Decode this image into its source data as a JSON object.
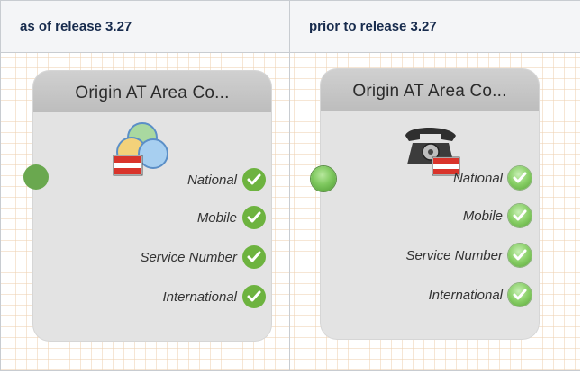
{
  "columns": [
    {
      "header": "as of release 3.27",
      "node": {
        "title": "Origin AT Area Co...",
        "icon": "area-code-flag-icon",
        "exits": [
          {
            "label": "National"
          },
          {
            "label": "Mobile"
          },
          {
            "label": "Service Number"
          },
          {
            "label": "International"
          }
        ]
      }
    },
    {
      "header": "prior to release 3.27",
      "node": {
        "title": "Origin AT Area Co...",
        "icon": "telephone-flag-icon",
        "exits": [
          {
            "label": "National"
          },
          {
            "label": "Mobile"
          },
          {
            "label": "Service Number"
          },
          {
            "label": "International"
          }
        ]
      }
    }
  ],
  "colors": {
    "header_bg": "#f4f5f7",
    "border": "#c8ccd1",
    "node_bg": "#e3e3e3",
    "port_green": "#6aa84f",
    "check_green": "#6db33f",
    "flag_red": "#d9342b"
  }
}
